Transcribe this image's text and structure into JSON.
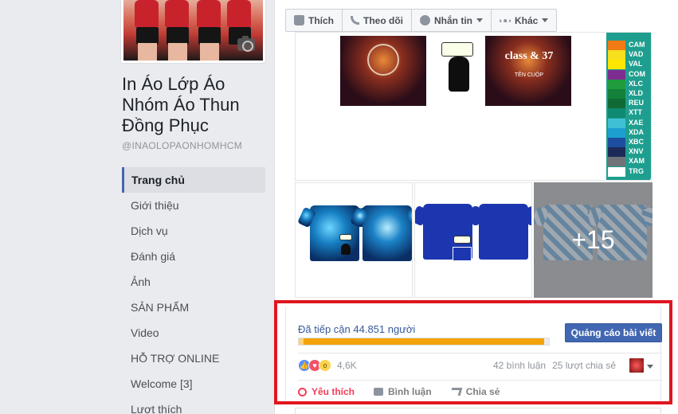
{
  "page": {
    "name": "In Áo Lớp Áo Nhóm Áo Thun Đồng Phục",
    "handle": "@INAOLOPAONHOMHCM"
  },
  "nav": {
    "items": [
      {
        "label": "Trang chủ",
        "active": true
      },
      {
        "label": "Giới thiệu"
      },
      {
        "label": "Dịch vụ"
      },
      {
        "label": "Đánh giá"
      },
      {
        "label": "Ảnh"
      },
      {
        "label": "SẢN PHẨM"
      },
      {
        "label": "Video"
      },
      {
        "label": "HỖ TRỢ ONLINE"
      },
      {
        "label": "Welcome [3]"
      },
      {
        "label": "Lượt thích"
      }
    ]
  },
  "toolbar": {
    "like_label": "Thích",
    "follow_label": "Theo dõi",
    "message_label": "Nhắn tin",
    "more_label": "Khác"
  },
  "photos": {
    "top_art_text": "class & 37",
    "top_art_subtext": "TÊN CUỘP",
    "swatches": [
      {
        "code": "CAM",
        "color": "#f07b15"
      },
      {
        "code": "VAD",
        "color": "#f7df1e"
      },
      {
        "code": "VAL",
        "color": "#ffe600"
      },
      {
        "code": "COM",
        "color": "#7f2c91"
      },
      {
        "code": "XLC",
        "color": "#1f9d3e"
      },
      {
        "code": "XLD",
        "color": "#14803a"
      },
      {
        "code": "REU",
        "color": "#0f6a33"
      },
      {
        "code": "XTT",
        "color": "#0f8a72"
      },
      {
        "code": "XAE",
        "color": "#3fc1d4"
      },
      {
        "code": "XDA",
        "color": "#1e9fd1"
      },
      {
        "code": "XBC",
        "color": "#1d4ea0"
      },
      {
        "code": "XNV",
        "color": "#1c2a58"
      },
      {
        "code": "XAM",
        "color": "#6f7378"
      },
      {
        "code": "TRG",
        "color": "#ffffff"
      }
    ],
    "more_count": "+15"
  },
  "post": {
    "reach_text": "Đã tiếp cận 44.851 người",
    "reach_fraction": 0.98,
    "boost_label": "Quảng cáo bài viết",
    "reactions_count": "4,6K",
    "comments_text": "42 bình luận",
    "shares_text": "25 lượt chia sẻ",
    "actions": {
      "love_label": "Yêu thích",
      "comment_label": "Bình luận",
      "share_label": "Chia sẻ"
    }
  },
  "colors": {
    "highlight_border": "#e0161f",
    "brand_blue": "#4267b2",
    "reach_bar": "#f5a30a"
  }
}
